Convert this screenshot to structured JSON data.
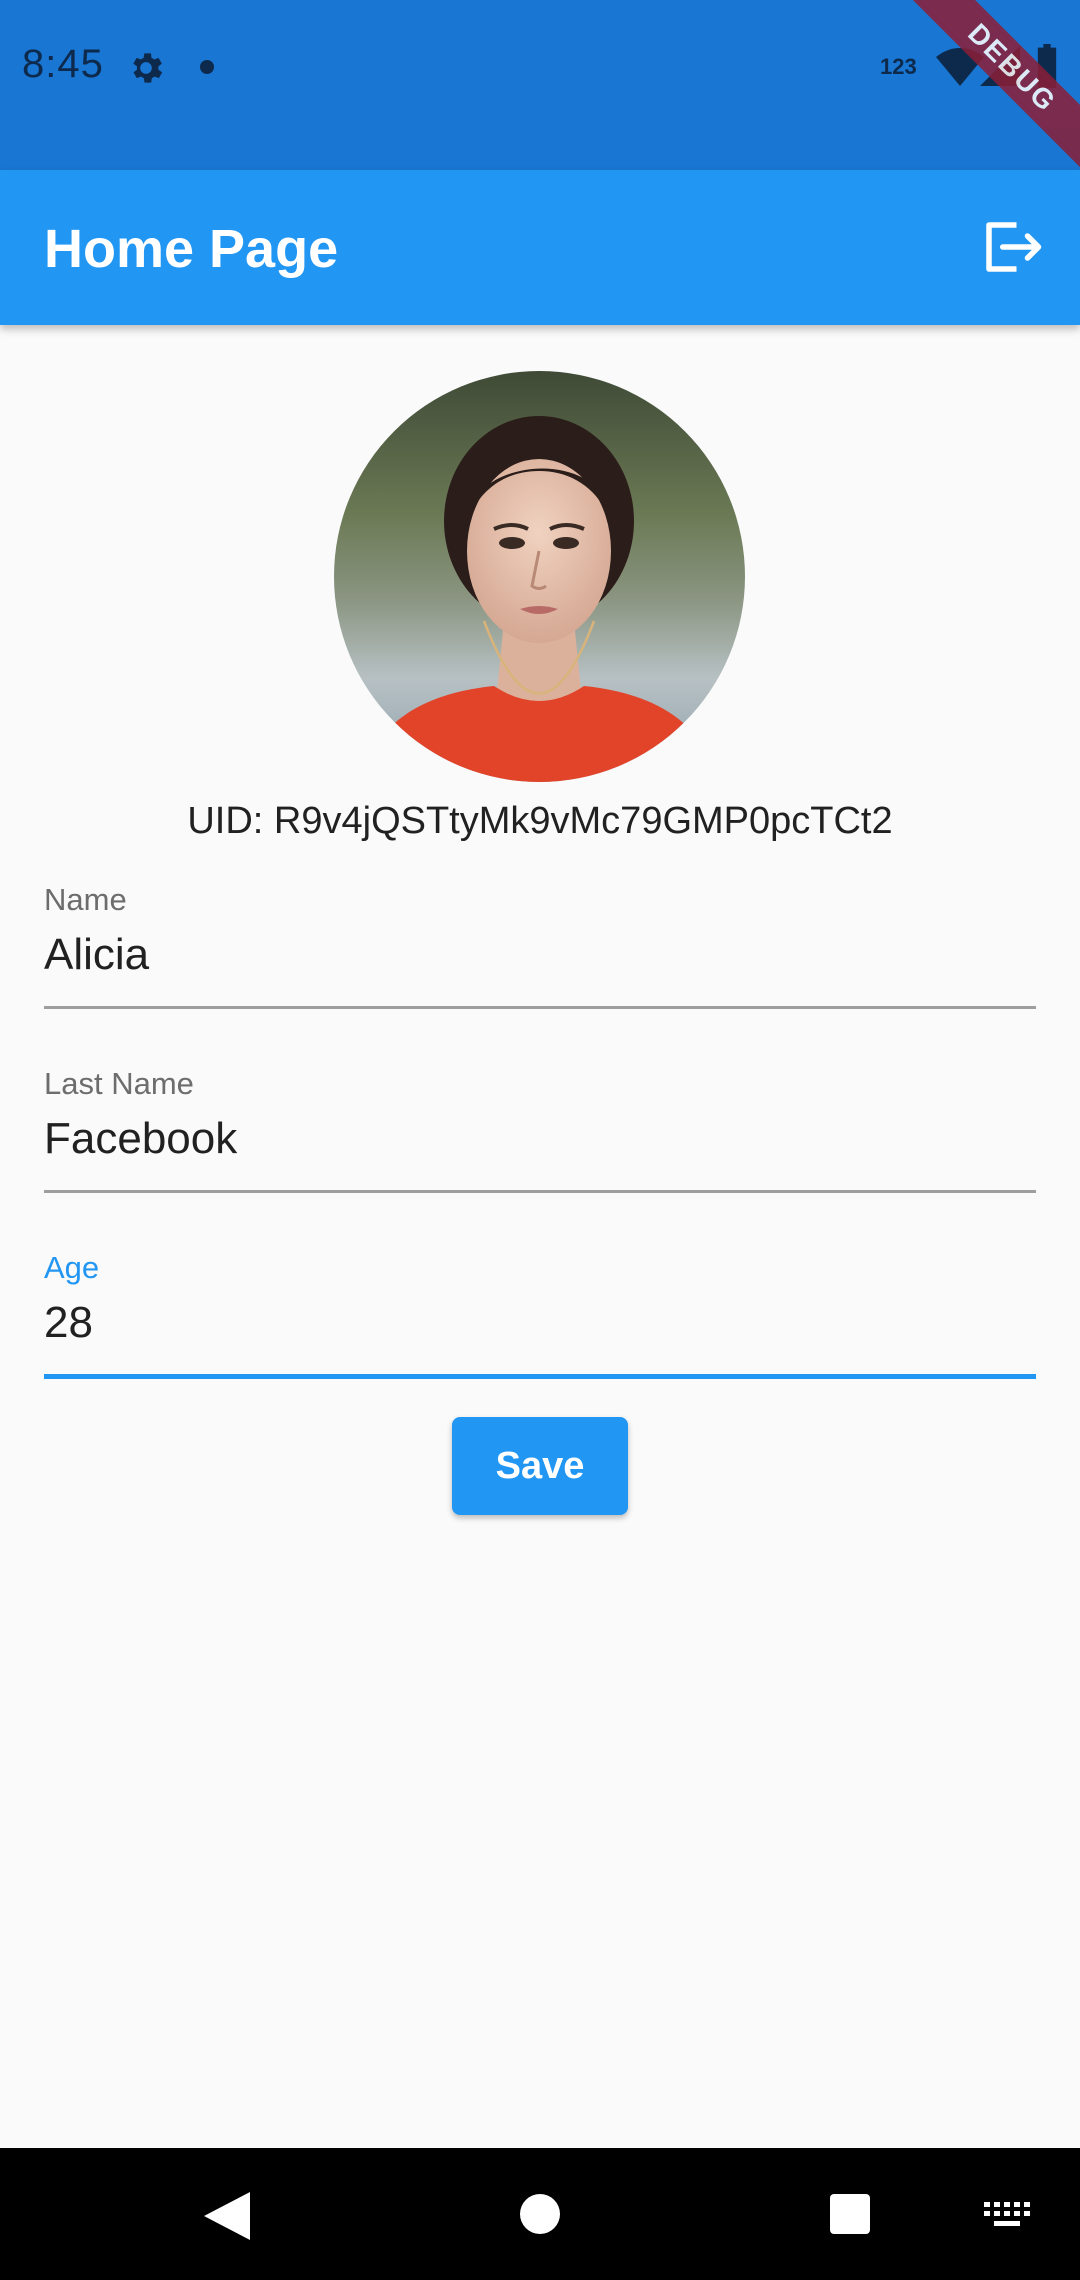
{
  "status_bar": {
    "time": "8:45",
    "network_label": "123",
    "icons": [
      "settings-icon",
      "notification-dot-icon",
      "wifi-icon",
      "signal-icon",
      "battery-icon"
    ]
  },
  "debug_banner": "DEBUG",
  "app_bar": {
    "title": "Home Page",
    "action_icon": "logout-icon"
  },
  "profile": {
    "avatar_alt": "profile photo",
    "uid": "UID: R9v4jQSTtyMk9vMc79GMP0pcTCt2"
  },
  "form": {
    "name": {
      "label": "Name",
      "value": "Alicia"
    },
    "last_name": {
      "label": "Last Name",
      "value": "Facebook"
    },
    "age": {
      "label": "Age",
      "value": "28",
      "focused": true
    },
    "save_label": "Save"
  },
  "nav_bar": {
    "buttons": [
      "back-icon",
      "home-icon",
      "recents-icon",
      "keyboard-icon"
    ]
  },
  "colors": {
    "status_bar": "#1976d2",
    "app_bar": "#2196f3",
    "accent": "#2196f3",
    "background": "#fafafa",
    "debug_ribbon": "#8b1f37"
  }
}
